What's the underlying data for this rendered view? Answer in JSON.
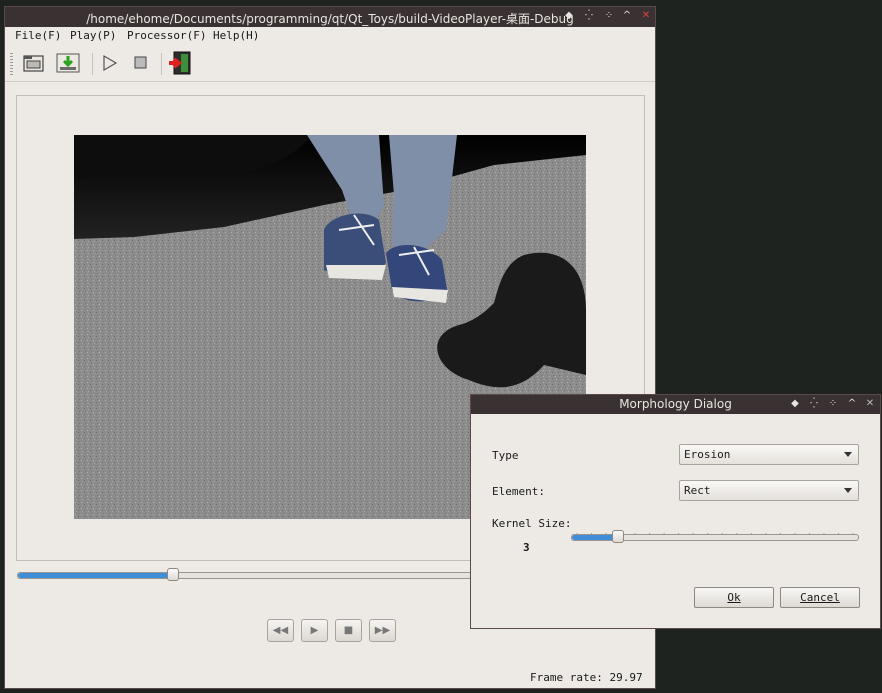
{
  "main_window": {
    "title": "/home/ehome/Documents/programming/qt/Qt_Toys/build-VideoPlayer-桌面-Debug",
    "menu": [
      {
        "label": "File(F)"
      },
      {
        "label": "Play(P)"
      },
      {
        "label": "Processor(F)"
      },
      {
        "label": "Help(H)"
      }
    ],
    "toolbar": {
      "icons": [
        "open-folder-icon",
        "download-icon",
        "play-icon",
        "stop-icon",
        "exit-icon"
      ]
    },
    "seek": {
      "progress": 0.33
    },
    "playback_buttons": [
      "rewind-icon",
      "play-icon",
      "stop-icon",
      "fast-forward-icon"
    ],
    "status": {
      "frame_rate_label": "Frame rate:",
      "frame_rate_value": "29.97"
    }
  },
  "dialog": {
    "title": "Morphology Dialog",
    "type_label": "Type",
    "type_value": "Erosion",
    "element_label": "Element:",
    "element_value": "Rect",
    "kernel_label": "Kernel Size:",
    "kernel_value": "3",
    "kernel_slider_fraction": 0.16,
    "ok_label": "Ok",
    "cancel_label": "Cancel"
  },
  "colors": {
    "titlebar_bg": "#3a3232",
    "window_bg": "#edeae5",
    "accent": "#3f8fd8",
    "desktop_bg": "#1f231f"
  }
}
